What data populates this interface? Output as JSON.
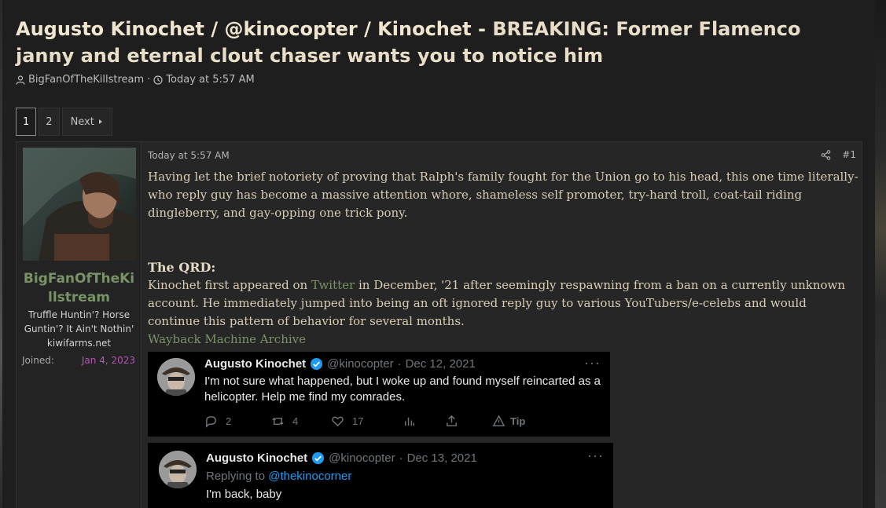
{
  "thread": {
    "title_prefix": "Augusto Kinochet / @kinocopter / Kinochet -",
    "title_text": "BREAKING: Former Flamenco janny and eternal clout chaser wants you to notice him",
    "author": "BigFanOfTheKillstream",
    "separator": "·",
    "time": "Today at 5:57 AM"
  },
  "pagination": {
    "pages": [
      "1",
      "2"
    ],
    "current": "1",
    "next_label": "Next"
  },
  "post": {
    "user": {
      "name": "BigFanOfTheKillstream",
      "title": "Truffle Huntin'? Horse Guntin'? It Ain't Nothin'",
      "domain": "kiwifarms.net",
      "joined_label": "Joined:",
      "joined_value": "Jan 4, 2023"
    },
    "date": "Today at 5:57 AM",
    "number": "#1",
    "intro": "Having let the brief notoriety of proving that Ralph's family fought for the Union go to his head, this one time literally-who reply guy has become a massive attention whore, shameless self promoter, try-hard troll, coat-tail riding dingleberry, and gay-opping one trick pony.",
    "qrd_heading": "The QRD:",
    "qrd_before": "Kinochet first appeared on",
    "qrd_link": "Twitter",
    "qrd_after": "in December, '21 after seemingly respawning from a ban on a currently unknown account. He immediately jumped into being an oft ignored reply guy to various YouTubers/e-celebs and would continue this pattern of behavior for several months.",
    "archive_link": "Wayback Machine Archive"
  },
  "tweets": [
    {
      "name": "Augusto Kinochet",
      "handle": "@kinocopter",
      "date": "Dec 12, 2021",
      "text": "I'm not sure what happened, but I woke up and found myself reincarted as a helicopter. Help me find my comrades.",
      "replies": "2",
      "retweets": "4",
      "likes": "17",
      "tip_label": "Tip",
      "more": "···"
    },
    {
      "name": "Augusto Kinochet",
      "handle": "@kinocopter",
      "date": "Dec 13, 2021",
      "replying_to_label": "Replying to",
      "replying_to": "@thekinocorner",
      "text": "I'm back, baby",
      "more": "···"
    }
  ],
  "colors": {
    "username_green": "#7a9268",
    "joined_purple": "#b355b3",
    "verified_blue": "#1d9bf0",
    "body_text": "#d8cdb4"
  },
  "icons": [
    "user-icon",
    "clock-icon",
    "share-icon",
    "verified-badge-icon",
    "reply-icon",
    "retweet-icon",
    "like-icon",
    "views-icon",
    "share-up-icon",
    "tip-icon",
    "caret-right-icon"
  ]
}
